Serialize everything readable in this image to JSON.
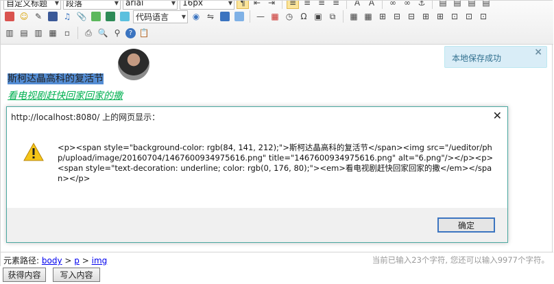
{
  "toolbar": {
    "row1": {
      "custom_title_select": "自定义标题",
      "paragraph_select": "段落",
      "font_family_select": "arial",
      "font_size_select": "16px"
    },
    "row2": {
      "code_language_select": "代码语言"
    }
  },
  "content": {
    "paragraph1_text": "斯柯达晶高科的复活节",
    "paragraph2_text": "看电视剧赶快回家回家的撒"
  },
  "toast": {
    "message": "本地保存成功",
    "close_glyph": "×"
  },
  "dialog": {
    "title": "http://localhost:8080/ 上的网页显示：",
    "close_glyph": "✕",
    "message": "<p><span style=\"background-color: rgb(84, 141, 212);\">斯柯达晶高科的复活节</span><img src=\"/ueditor/php/upload/image/20160704/1467600934975616.png\" title=\"1467600934975616.png\" alt=\"6.png\"/></p><p><span style=\"text-decoration: underline; color: rgb(0, 176, 80);\"><em>看电视剧赶快回家回家的撒</em></span></p>",
    "ok_label": "确定"
  },
  "statusbar": {
    "path_label": "元素路径:",
    "path_items": [
      "body",
      "p",
      "img"
    ],
    "path_sep": ">",
    "word_count": "当前已输入23个字符, 您还可以输入9977个字符。"
  },
  "buttons": {
    "get_content": "获得内容",
    "write_content": "写入内容"
  },
  "colors": {
    "highlight": "#548dd4",
    "green_text": "#00b050",
    "toast_bg": "#d9edf7",
    "dialog_border": "#4aa8a0",
    "ok_border": "#3b74c0"
  }
}
